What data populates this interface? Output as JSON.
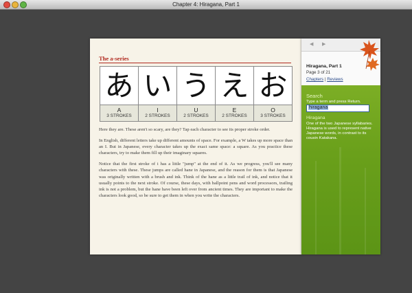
{
  "window": {
    "title": "Chapter 4: Hiragana, Part 1"
  },
  "page": {
    "section_title": "The a-series",
    "kana": [
      {
        "glyph": "あ",
        "romaji": "A",
        "strokes": "3 STROKES"
      },
      {
        "glyph": "い",
        "romaji": "I",
        "strokes": "2 STROKES"
      },
      {
        "glyph": "う",
        "romaji": "U",
        "strokes": "2 STROKES"
      },
      {
        "glyph": "え",
        "romaji": "E",
        "strokes": "2 STROKES"
      },
      {
        "glyph": "お",
        "romaji": "O",
        "strokes": "3 STROKES"
      }
    ],
    "paragraphs": [
      "Here they are. These aren't so scary, are they? Tap each character to see its proper stroke order.",
      "In English, different letters take up different amounts of space. For example, a W takes up more space than an I. But in Japanese, every character takes up the exact same space: a square. As you practice these characters, try to make them fill up their imaginary squares.",
      "Notice that the first stroke of i has a little \"jump\" at the end of it. As we progress, you'll see many characters with these. These jumps are called hane in Japanese, and the reason for them is that Japanese was originally written with a brush and ink. Think of the hane as a little trail of ink, and notice that it usually points to the next stroke. Of course, these days, with ballpoint pens and word processors, trailing ink is not a problem, but the hane have been left over from ancient times. They are important to make the characters look good, so be sure to get them in when you write the characters."
    ]
  },
  "sidebar": {
    "prev_label": "◀",
    "next_label": "▶",
    "chapter_title": "Hiragana, Part 1",
    "page_info": "Page 3 of 21",
    "chapters_link": "Chapters",
    "separator": "|",
    "reviews_link": "Reviews",
    "search": {
      "label": "Search",
      "help": "Type a term and press Return.",
      "value": "hiragana"
    },
    "definition": {
      "title": "Hiragana",
      "text": "One of the two Japanese syllabaries. Hiragana is used to represent native Japanese words, in contrast to its cousin Katakana."
    }
  },
  "colors": {
    "accent_red": "#b0281e",
    "sidebar_green": "#6aa01b",
    "maple_leaf": "#d9541c"
  }
}
